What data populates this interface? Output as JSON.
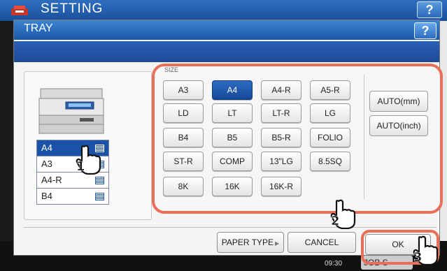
{
  "background": {
    "title": "SETTING",
    "help_label": "?",
    "clock": "09:30",
    "job_button": "JOB S"
  },
  "dialog": {
    "title": "TRAY",
    "help_label": "?"
  },
  "trays": [
    {
      "label": "A4",
      "selected": true
    },
    {
      "label": "A3",
      "selected": false
    },
    {
      "label": "A4-R",
      "selected": false
    },
    {
      "label": "B4",
      "selected": false
    }
  ],
  "size_section_label": "SIZE",
  "sizes": [
    {
      "label": "A3",
      "selected": false
    },
    {
      "label": "A4",
      "selected": true
    },
    {
      "label": "A4-R",
      "selected": false
    },
    {
      "label": "A5-R",
      "selected": false
    },
    {
      "label": "LD",
      "selected": false
    },
    {
      "label": "LT",
      "selected": false
    },
    {
      "label": "LT-R",
      "selected": false
    },
    {
      "label": "LG",
      "selected": false
    },
    {
      "label": "B4",
      "selected": false
    },
    {
      "label": "B5",
      "selected": false
    },
    {
      "label": "B5-R",
      "selected": false
    },
    {
      "label": "FOLIO",
      "selected": false
    },
    {
      "label": "ST-R",
      "selected": false
    },
    {
      "label": "COMP",
      "selected": false
    },
    {
      "label": "13\"LG",
      "selected": false
    },
    {
      "label": "8.5SQ",
      "selected": false
    },
    {
      "label": "8K",
      "selected": false
    },
    {
      "label": "16K",
      "selected": false
    },
    {
      "label": "16K-R",
      "selected": false
    }
  ],
  "auto_buttons": [
    "AUTO(mm)",
    "AUTO(inch)"
  ],
  "footer": {
    "paper_type": "PAPER TYPE",
    "cancel": "CANCEL",
    "ok": "OK"
  },
  "step_markers": [
    "1",
    "2",
    "3"
  ],
  "colors": {
    "highlight": "#e96f5a",
    "selected": "#1a52a8"
  }
}
